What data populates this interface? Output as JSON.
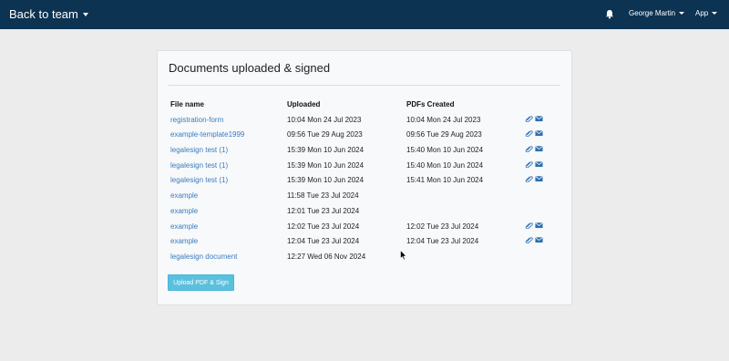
{
  "nav": {
    "brand": "Back to team",
    "user": "George Martin",
    "app": "App"
  },
  "card": {
    "title": "Documents uploaded & signed",
    "columns": [
      "File name",
      "Uploaded",
      "PDFs Created"
    ],
    "rows": [
      {
        "name": "registration-form",
        "uploaded": "10:04 Mon 24 Jul 2023",
        "created": "10:04 Mon 24 Jul 2023",
        "actions": true
      },
      {
        "name": "example-template1999",
        "uploaded": "09:56 Tue 29 Aug 2023",
        "created": "09:56 Tue 29 Aug 2023",
        "actions": true
      },
      {
        "name": "legalesign test (1)",
        "uploaded": "15:39 Mon 10 Jun 2024",
        "created": "15:40 Mon 10 Jun 2024",
        "actions": true
      },
      {
        "name": "legalesign test (1)",
        "uploaded": "15:39 Mon 10 Jun 2024",
        "created": "15:40 Mon 10 Jun 2024",
        "actions": true
      },
      {
        "name": "legalesign test (1)",
        "uploaded": "15:39 Mon 10 Jun 2024",
        "created": "15:41 Mon 10 Jun 2024",
        "actions": true
      },
      {
        "name": "example",
        "uploaded": "11:58 Tue 23 Jul 2024",
        "created": "",
        "actions": false
      },
      {
        "name": "example",
        "uploaded": "12:01 Tue 23 Jul 2024",
        "created": "",
        "actions": false
      },
      {
        "name": "example",
        "uploaded": "12:02 Tue 23 Jul 2024",
        "created": "12:02 Tue 23 Jul 2024",
        "actions": true
      },
      {
        "name": "example",
        "uploaded": "12:04 Tue 23 Jul 2024",
        "created": "12:04 Tue 23 Jul 2024",
        "actions": true
      },
      {
        "name": "legalesign document",
        "uploaded": "12:27 Wed 06 Nov 2024",
        "created": "",
        "actions": false
      }
    ],
    "upload_button": "Upload PDF & Sign"
  },
  "icons": {
    "attach": "paperclip-icon",
    "email": "envelope-icon",
    "bell": "bell-icon"
  },
  "colors": {
    "navbar": "#0d3352",
    "link": "#3a7cc0",
    "button": "#5bc0de"
  }
}
